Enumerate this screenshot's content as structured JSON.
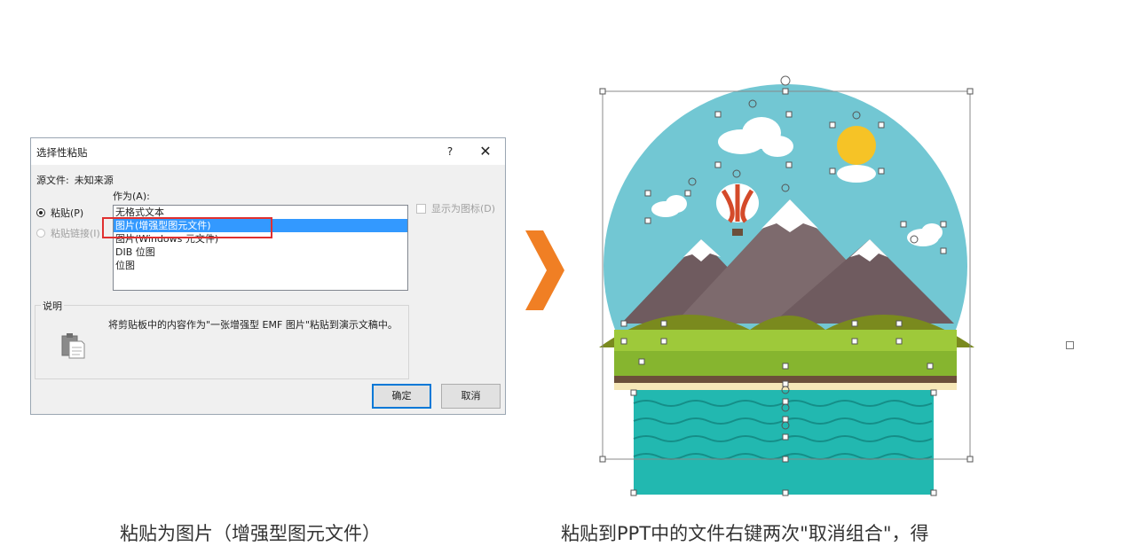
{
  "dialog": {
    "title": "选择性粘贴",
    "help": "?",
    "close": "✕",
    "source_label": "源文件:",
    "source_value": "未知来源",
    "as_label": "作为",
    "as_key": "(A):",
    "paste_label": "粘贴(P)",
    "paste_link_label": "粘贴链接(I)",
    "options": [
      "无格式文本",
      "图片(增强型图元文件)",
      "图片(Windows 元文件)",
      "DIB 位图",
      "位图"
    ],
    "selected_index": 1,
    "display_icon_label": "显示为图标(D)",
    "desc_title": "说明",
    "desc_text": "将剪贴板中的内容作为\"一张增强型 EMF 图片\"粘贴到演示文稿中。",
    "ok_label": "确定",
    "cancel_label": "取消"
  },
  "captions": {
    "left": "粘贴为图片（增强型图元文件）",
    "right": "粘贴到PPT中的文件右键两次\"取消组合\"，得"
  },
  "colors": {
    "sky": "#72c7d3",
    "arrow": "#f07f24",
    "selection": "#3399ff",
    "highlight": "#e03030",
    "water": "#22b8b0"
  },
  "icons": {
    "clipboard": "clipboard-icon",
    "arrow": "chevron-right-icon"
  }
}
